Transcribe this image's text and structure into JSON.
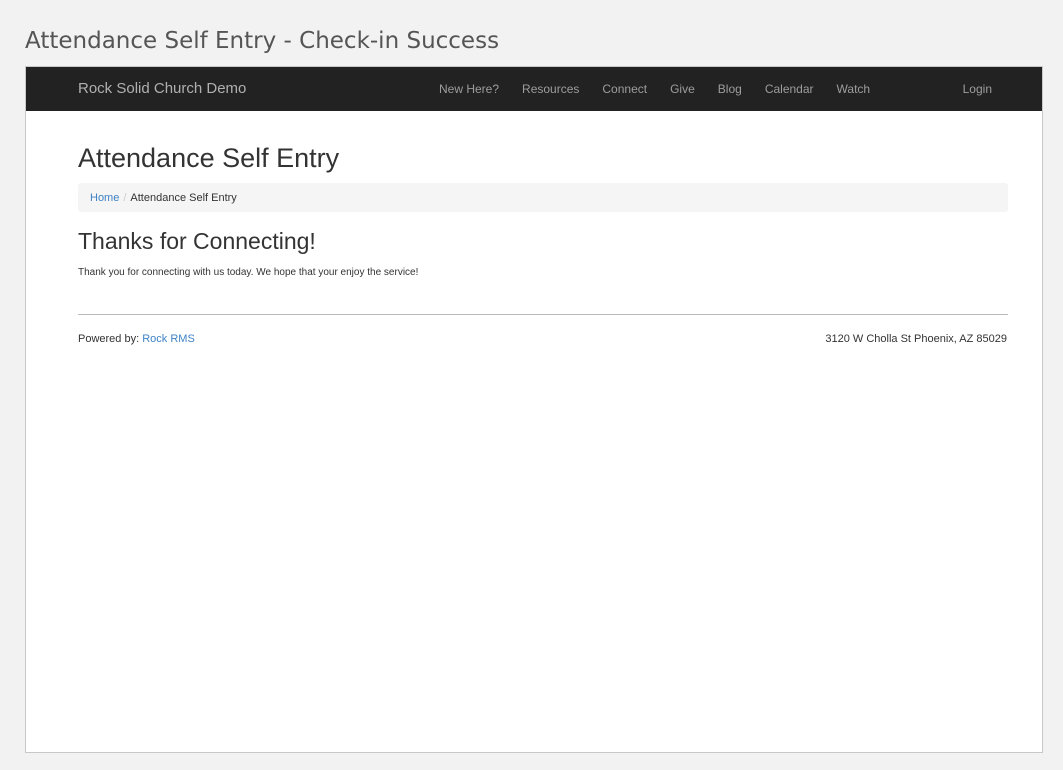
{
  "caption": "Attendance Self Entry - Check-in Success",
  "navbar": {
    "brand": "Rock Solid Church Demo",
    "links": [
      "New Here?",
      "Resources",
      "Connect",
      "Give",
      "Blog",
      "Calendar",
      "Watch"
    ],
    "login": "Login"
  },
  "page": {
    "title": "Attendance Self Entry",
    "breadcrumb": {
      "home": "Home",
      "separator": "/",
      "current": "Attendance Self Entry"
    },
    "heading": "Thanks for Connecting!",
    "message": "Thank you for connecting with us today. We hope that your enjoy the service!"
  },
  "footer": {
    "powered_prefix": "Powered by:",
    "powered_link": "Rock RMS",
    "address": "3120 W Cholla St Phoenix, AZ 85029"
  },
  "colors": {
    "navbar_bg": "#222222",
    "link": "#3e82c4",
    "breadcrumb_bg": "#f5f5f5"
  }
}
